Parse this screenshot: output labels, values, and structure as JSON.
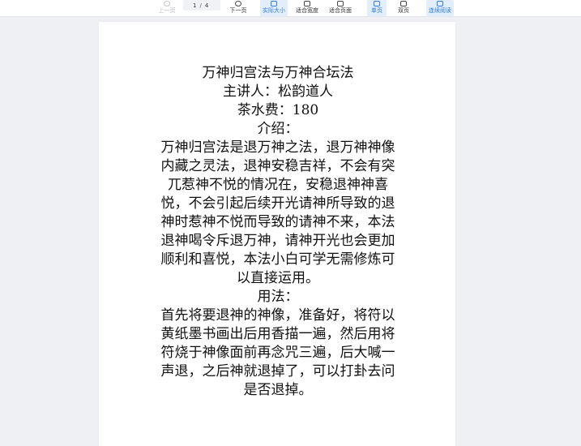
{
  "toolbar": {
    "prev_label": "上一页",
    "page_current": "1",
    "page_total": "4",
    "next_label": "下一页",
    "actual_size_label": "实际大小",
    "fit_width_label": "适合宽度",
    "fit_page_label": "适合页面",
    "single_page_label": "单页",
    "double_page_label": "双页",
    "continuous_label": "连续阅读"
  },
  "document": {
    "title": "万神归宫法与万神合坛法",
    "speaker": "主讲人：松韵道人",
    "fee": "茶水费：180",
    "intro_heading": "介绍：",
    "intro_text": "万神归宫法是退万神之法，退万神神像内藏之灵法，退神安稳吉祥，不会有突兀惹神不悦的情况在，安稳退神神喜悦，不会引起后续开光请神所导致的退神时惹神不悦而导致的请神不来，本法退神喝令斥退万神，请神开光也会更加顺利和喜悦，本法小白可学无需修炼可以直接运用。",
    "usage_heading": "用法：",
    "usage_text": "首先将要退神的神像，准备好，将符以黄纸墨书画出后用香描一遍，然后用将符烧于神像面前再念咒三遍，后大喊一声退，之后神就退掉了，可以打卦去问是否退掉。"
  }
}
